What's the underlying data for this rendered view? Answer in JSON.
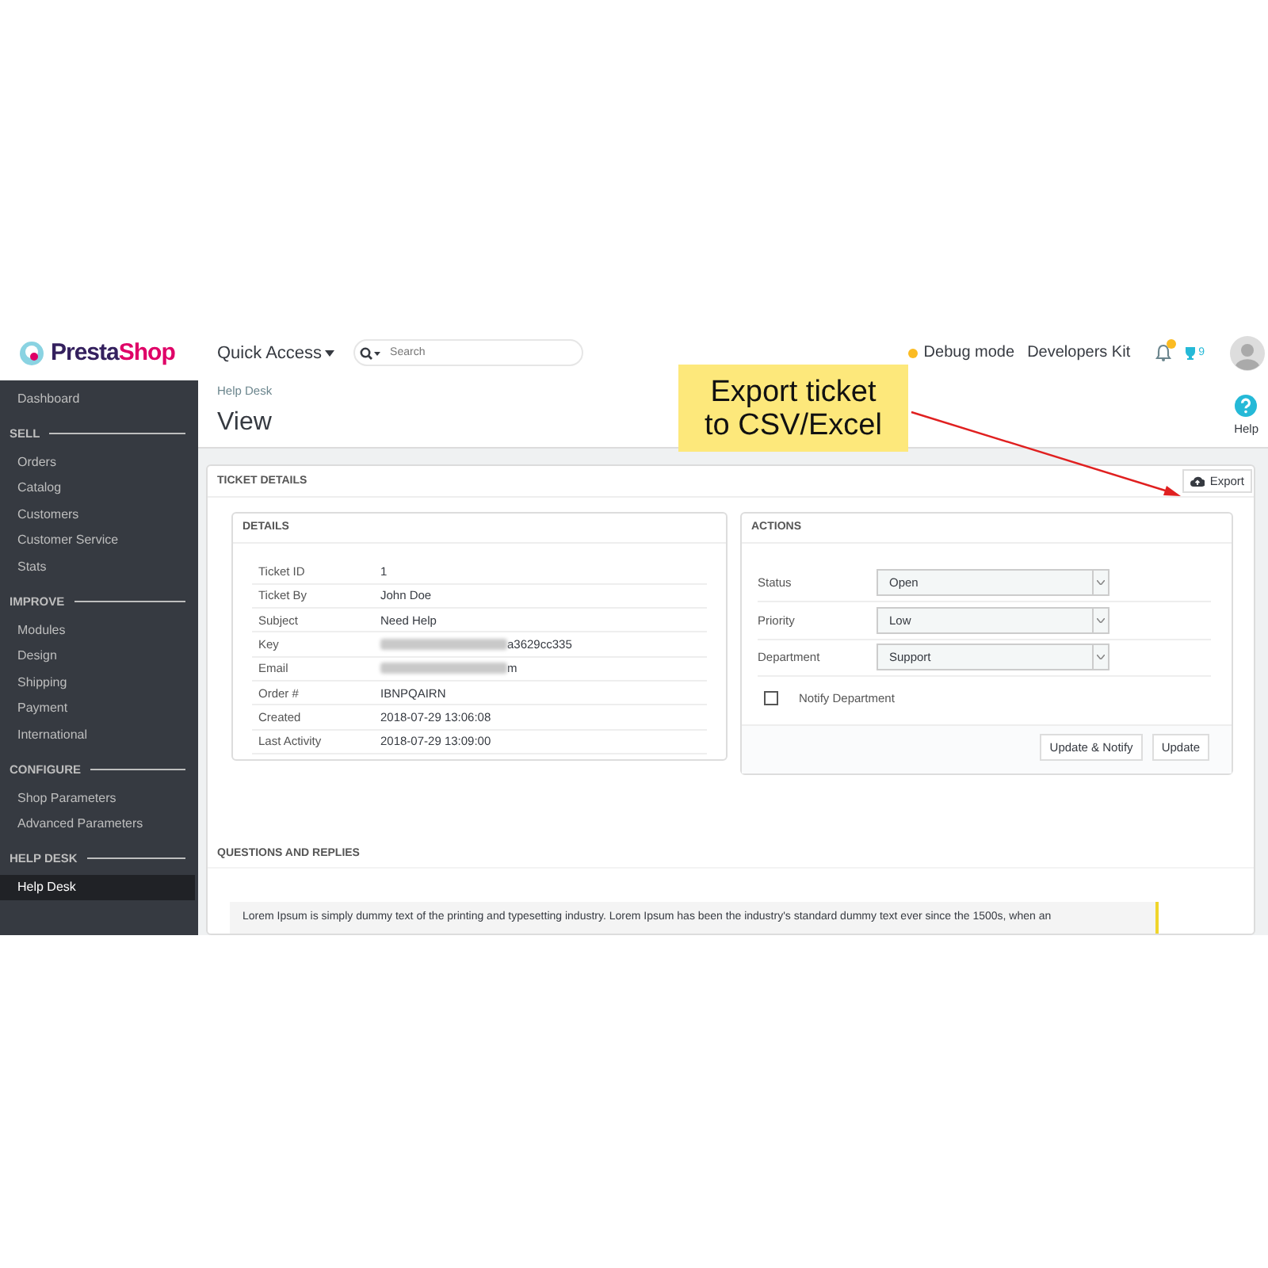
{
  "header": {
    "logo": "PrestaShop",
    "quick_access": "Quick Access",
    "search": {
      "placeholder": "Search"
    },
    "debug": {
      "label": "Debug mode",
      "on": true
    },
    "developers_kit": "Developers Kit",
    "trophy_count": "9"
  },
  "sidebar": {
    "items": [
      {
        "kind": "link",
        "label": "Dashboard",
        "selected": false
      },
      {
        "kind": "section",
        "label": "SELL"
      },
      {
        "kind": "link",
        "label": "Orders",
        "selected": false
      },
      {
        "kind": "link",
        "label": "Catalog",
        "selected": false
      },
      {
        "kind": "link",
        "label": "Customers",
        "selected": false
      },
      {
        "kind": "link",
        "label": "Customer Service",
        "selected": false
      },
      {
        "kind": "link",
        "label": "Stats",
        "selected": false
      },
      {
        "kind": "section",
        "label": "IMPROVE"
      },
      {
        "kind": "link",
        "label": "Modules",
        "selected": false
      },
      {
        "kind": "link",
        "label": "Design",
        "selected": false
      },
      {
        "kind": "link",
        "label": "Shipping",
        "selected": false
      },
      {
        "kind": "link",
        "label": "Payment",
        "selected": false
      },
      {
        "kind": "link",
        "label": "International",
        "selected": false
      },
      {
        "kind": "section",
        "label": "CONFIGURE"
      },
      {
        "kind": "link",
        "label": "Shop Parameters",
        "selected": false
      },
      {
        "kind": "link",
        "label": "Advanced Parameters",
        "selected": false
      },
      {
        "kind": "section",
        "label": "HELP DESK"
      },
      {
        "kind": "link",
        "label": "Help Desk",
        "selected": true
      }
    ]
  },
  "page": {
    "breadcrumb": "Help Desk",
    "title": "View",
    "help": "Help"
  },
  "ticket_panel": {
    "title": "TICKET DETAILS",
    "export_button": "Export",
    "details": {
      "title": "DETAILS",
      "rows": [
        {
          "label": "Ticket ID",
          "value": "1",
          "redacted": false
        },
        {
          "label": "Ticket By",
          "value": "John Doe",
          "redacted": false
        },
        {
          "label": "Subject",
          "value": "Need Help",
          "redacted": false
        },
        {
          "label": "Key",
          "value": "a3629cc335",
          "redacted": true
        },
        {
          "label": "Email",
          "value": "m",
          "redacted": true
        },
        {
          "label": "Order #",
          "value": "IBNPQAIRN",
          "redacted": false
        },
        {
          "label": "Created",
          "value": "2018-07-29 13:06:08",
          "redacted": false
        },
        {
          "label": "Last Activity",
          "value": "2018-07-29 13:09:00",
          "redacted": false
        }
      ]
    },
    "actions": {
      "title": "ACTIONS",
      "fields": [
        {
          "label": "Status",
          "value": "Open"
        },
        {
          "label": "Priority",
          "value": "Low"
        },
        {
          "label": "Department",
          "value": "Support"
        }
      ],
      "notify": {
        "label": "Notify Department",
        "checked": false
      },
      "buttons": [
        "Update & Notify",
        "Update"
      ]
    }
  },
  "replies": {
    "title": "QUESTIONS AND REPLIES",
    "message": "Lorem Ipsum is simply dummy text of the printing and typesetting industry. Lorem Ipsum has been the industry's standard dummy text ever since the 1500s, when an"
  },
  "callout": {
    "text": "Export ticket\nto CSV/Excel"
  }
}
